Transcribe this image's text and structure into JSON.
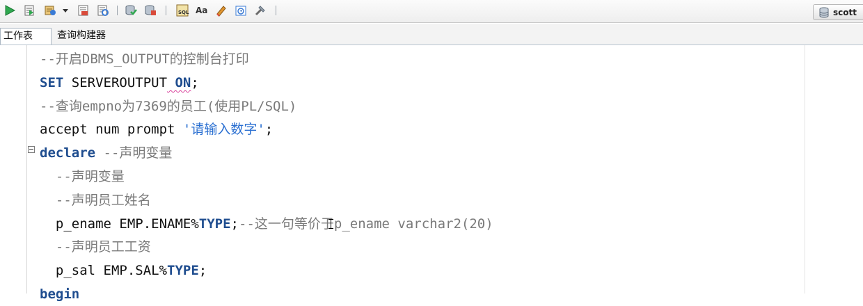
{
  "toolbar": {
    "buttons": [
      {
        "icon": "run-statement-icon",
        "tooltip": ""
      },
      {
        "icon": "run-script-icon",
        "tooltip": ""
      },
      {
        "icon": "autotrace-icon",
        "tooltip": ""
      },
      {
        "icon": "dropdown-arrow-icon",
        "tooltip": ""
      },
      {
        "icon": "explain-plan-icon",
        "tooltip": ""
      },
      {
        "icon": "sql-tuning-icon",
        "tooltip": ""
      },
      {
        "icon": "commit-icon",
        "tooltip": ""
      },
      {
        "icon": "rollback-icon",
        "tooltip": ""
      },
      {
        "icon": "unshared-sql-icon",
        "tooltip": ""
      },
      {
        "icon": "to-upper-lower-icon",
        "tooltip": ""
      },
      {
        "icon": "clear-icon",
        "tooltip": ""
      },
      {
        "icon": "sql-history-icon",
        "tooltip": ""
      },
      {
        "icon": "format-icon",
        "tooltip": ""
      }
    ],
    "connection": {
      "label": "scott",
      "icon": "database-connection-icon"
    }
  },
  "tabs": [
    {
      "label": "工作表",
      "active": true
    },
    {
      "label": "查询构建器",
      "active": false
    }
  ],
  "editor": {
    "lines": [
      {
        "segments": [
          {
            "t": "--开启DBMS_OUTPUT的控制台打印",
            "c": "cm"
          }
        ]
      },
      {
        "segments": [
          {
            "t": "SET",
            "c": "kw"
          },
          {
            "t": " SERVEROUTPUT",
            "c": ""
          },
          {
            "t": " ON",
            "c": "kw squig"
          },
          {
            "t": ";",
            "c": ""
          }
        ]
      },
      {
        "segments": [
          {
            "t": "--查询empno为7369的员工(使用PL/SQL)",
            "c": "cm"
          }
        ]
      },
      {
        "segments": [
          {
            "t": "accept num prompt ",
            "c": ""
          },
          {
            "t": "'请输入数字'",
            "c": "str"
          },
          {
            "t": ";",
            "c": ""
          }
        ]
      },
      {
        "segments": [
          {
            "t": "declare",
            "c": "kw"
          },
          {
            "t": " --声明变量",
            "c": "cm"
          }
        ]
      },
      {
        "segments": [
          {
            "t": "  --声明变量",
            "c": "cm"
          }
        ]
      },
      {
        "segments": [
          {
            "t": "  --声明员工姓名",
            "c": "cm"
          }
        ]
      },
      {
        "segments": [
          {
            "t": "  p_ename EMP.ENAME%",
            "c": ""
          },
          {
            "t": "TYPE",
            "c": "kw"
          },
          {
            "t": ";",
            "c": ""
          },
          {
            "t": "--这一句等价于p_ename varchar2(20)",
            "c": "cm"
          }
        ]
      },
      {
        "segments": [
          {
            "t": "  --声明员工工资",
            "c": "cm"
          }
        ]
      },
      {
        "segments": [
          {
            "t": "  p_sal EMP.SAL%",
            "c": ""
          },
          {
            "t": "TYPE",
            "c": "kw"
          },
          {
            "t": ";",
            "c": ""
          }
        ]
      },
      {
        "segments": [
          {
            "t": "begin",
            "c": "kw"
          }
        ]
      }
    ]
  },
  "colors": {
    "comment": "#7a7a7a",
    "keyword": "#1f4d8f",
    "string": "#2a6fd1",
    "squiggle": "#d9419b"
  }
}
